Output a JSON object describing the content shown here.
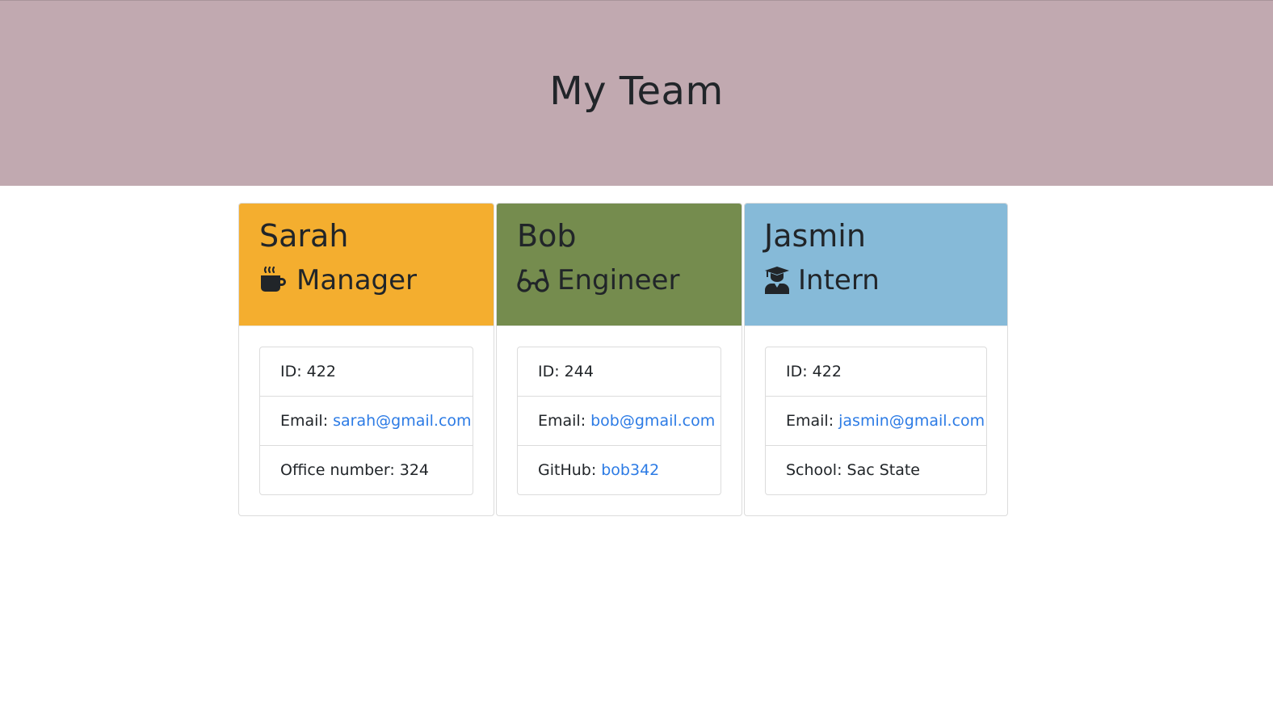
{
  "header": {
    "title": "My Team"
  },
  "colors": {
    "header_bg": "#c1a9b0",
    "manager": "#f4ae2f",
    "engineer": "#758c4e",
    "intern": "#86bad8",
    "link": "#2c7be5"
  },
  "team": [
    {
      "name": "Sarah",
      "role": "Manager",
      "icon": "coffee-mug-icon",
      "id_label": "ID: 422",
      "email_label": "Email:",
      "email": "sarah@gmail.com",
      "extra_label": "Office number: 324",
      "extra_link": ""
    },
    {
      "name": "Bob",
      "role": "Engineer",
      "icon": "glasses-icon",
      "id_label": "ID: 244",
      "email_label": "Email:",
      "email": "bob@gmail.com",
      "extra_label": "GitHub:",
      "extra_link": "bob342"
    },
    {
      "name": "Jasmin",
      "role": "Intern",
      "icon": "graduate-icon",
      "id_label": "ID: 422",
      "email_label": "Email:",
      "email": "jasmin@gmail.com",
      "extra_label": "School: Sac State",
      "extra_link": ""
    }
  ]
}
